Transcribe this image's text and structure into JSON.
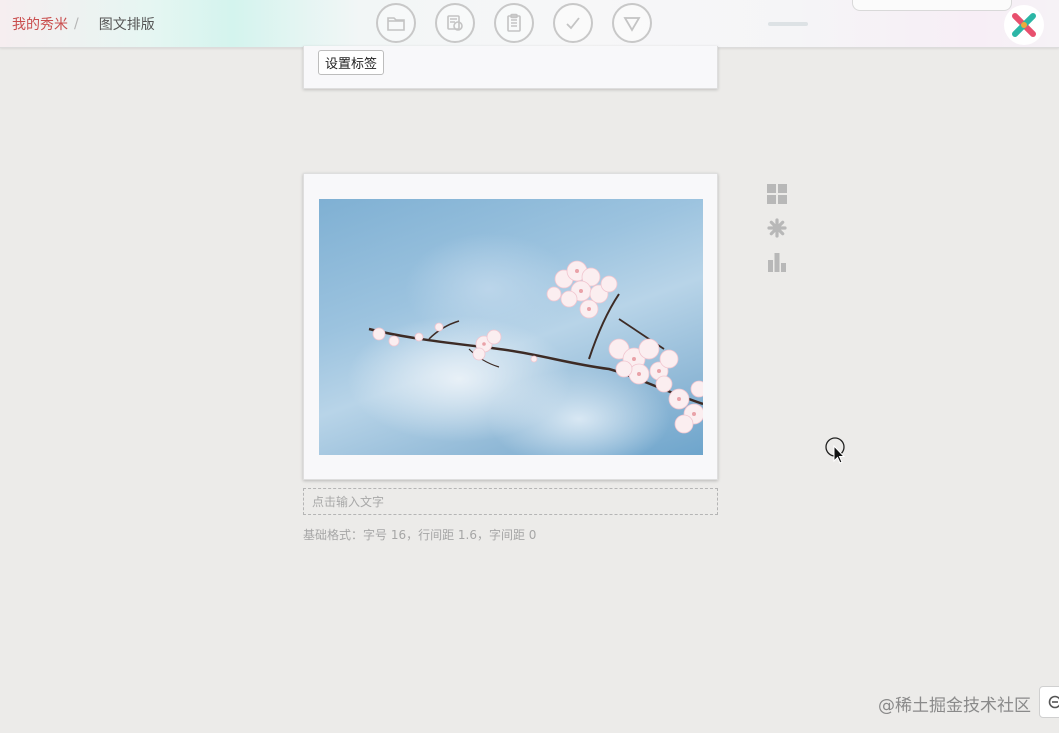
{
  "breadcrumb": {
    "home": "我的秀米",
    "separator": "/",
    "current": "图文排版"
  },
  "toolbar": {
    "buttons": [
      {
        "icon": "folder-icon"
      },
      {
        "icon": "image-library-icon"
      },
      {
        "icon": "clipboard-icon"
      },
      {
        "icon": "checkmark-icon"
      },
      {
        "icon": "triangle-down-icon"
      }
    ]
  },
  "top_card": {
    "tag_button_label": "设置标签"
  },
  "editor": {
    "text_placeholder": "点击输入文字",
    "format_info": "基础格式：字号 16，行间距 1.6，字间距 0"
  },
  "side_tools": [
    "grid-icon",
    "asterisk-icon",
    "bar-chart-icon"
  ],
  "watermark": "@稀土掘金技术社区",
  "colors": {
    "accent": "#c94d4d",
    "background": "#ecebe9",
    "icon_gray": "#b8b8b8"
  }
}
